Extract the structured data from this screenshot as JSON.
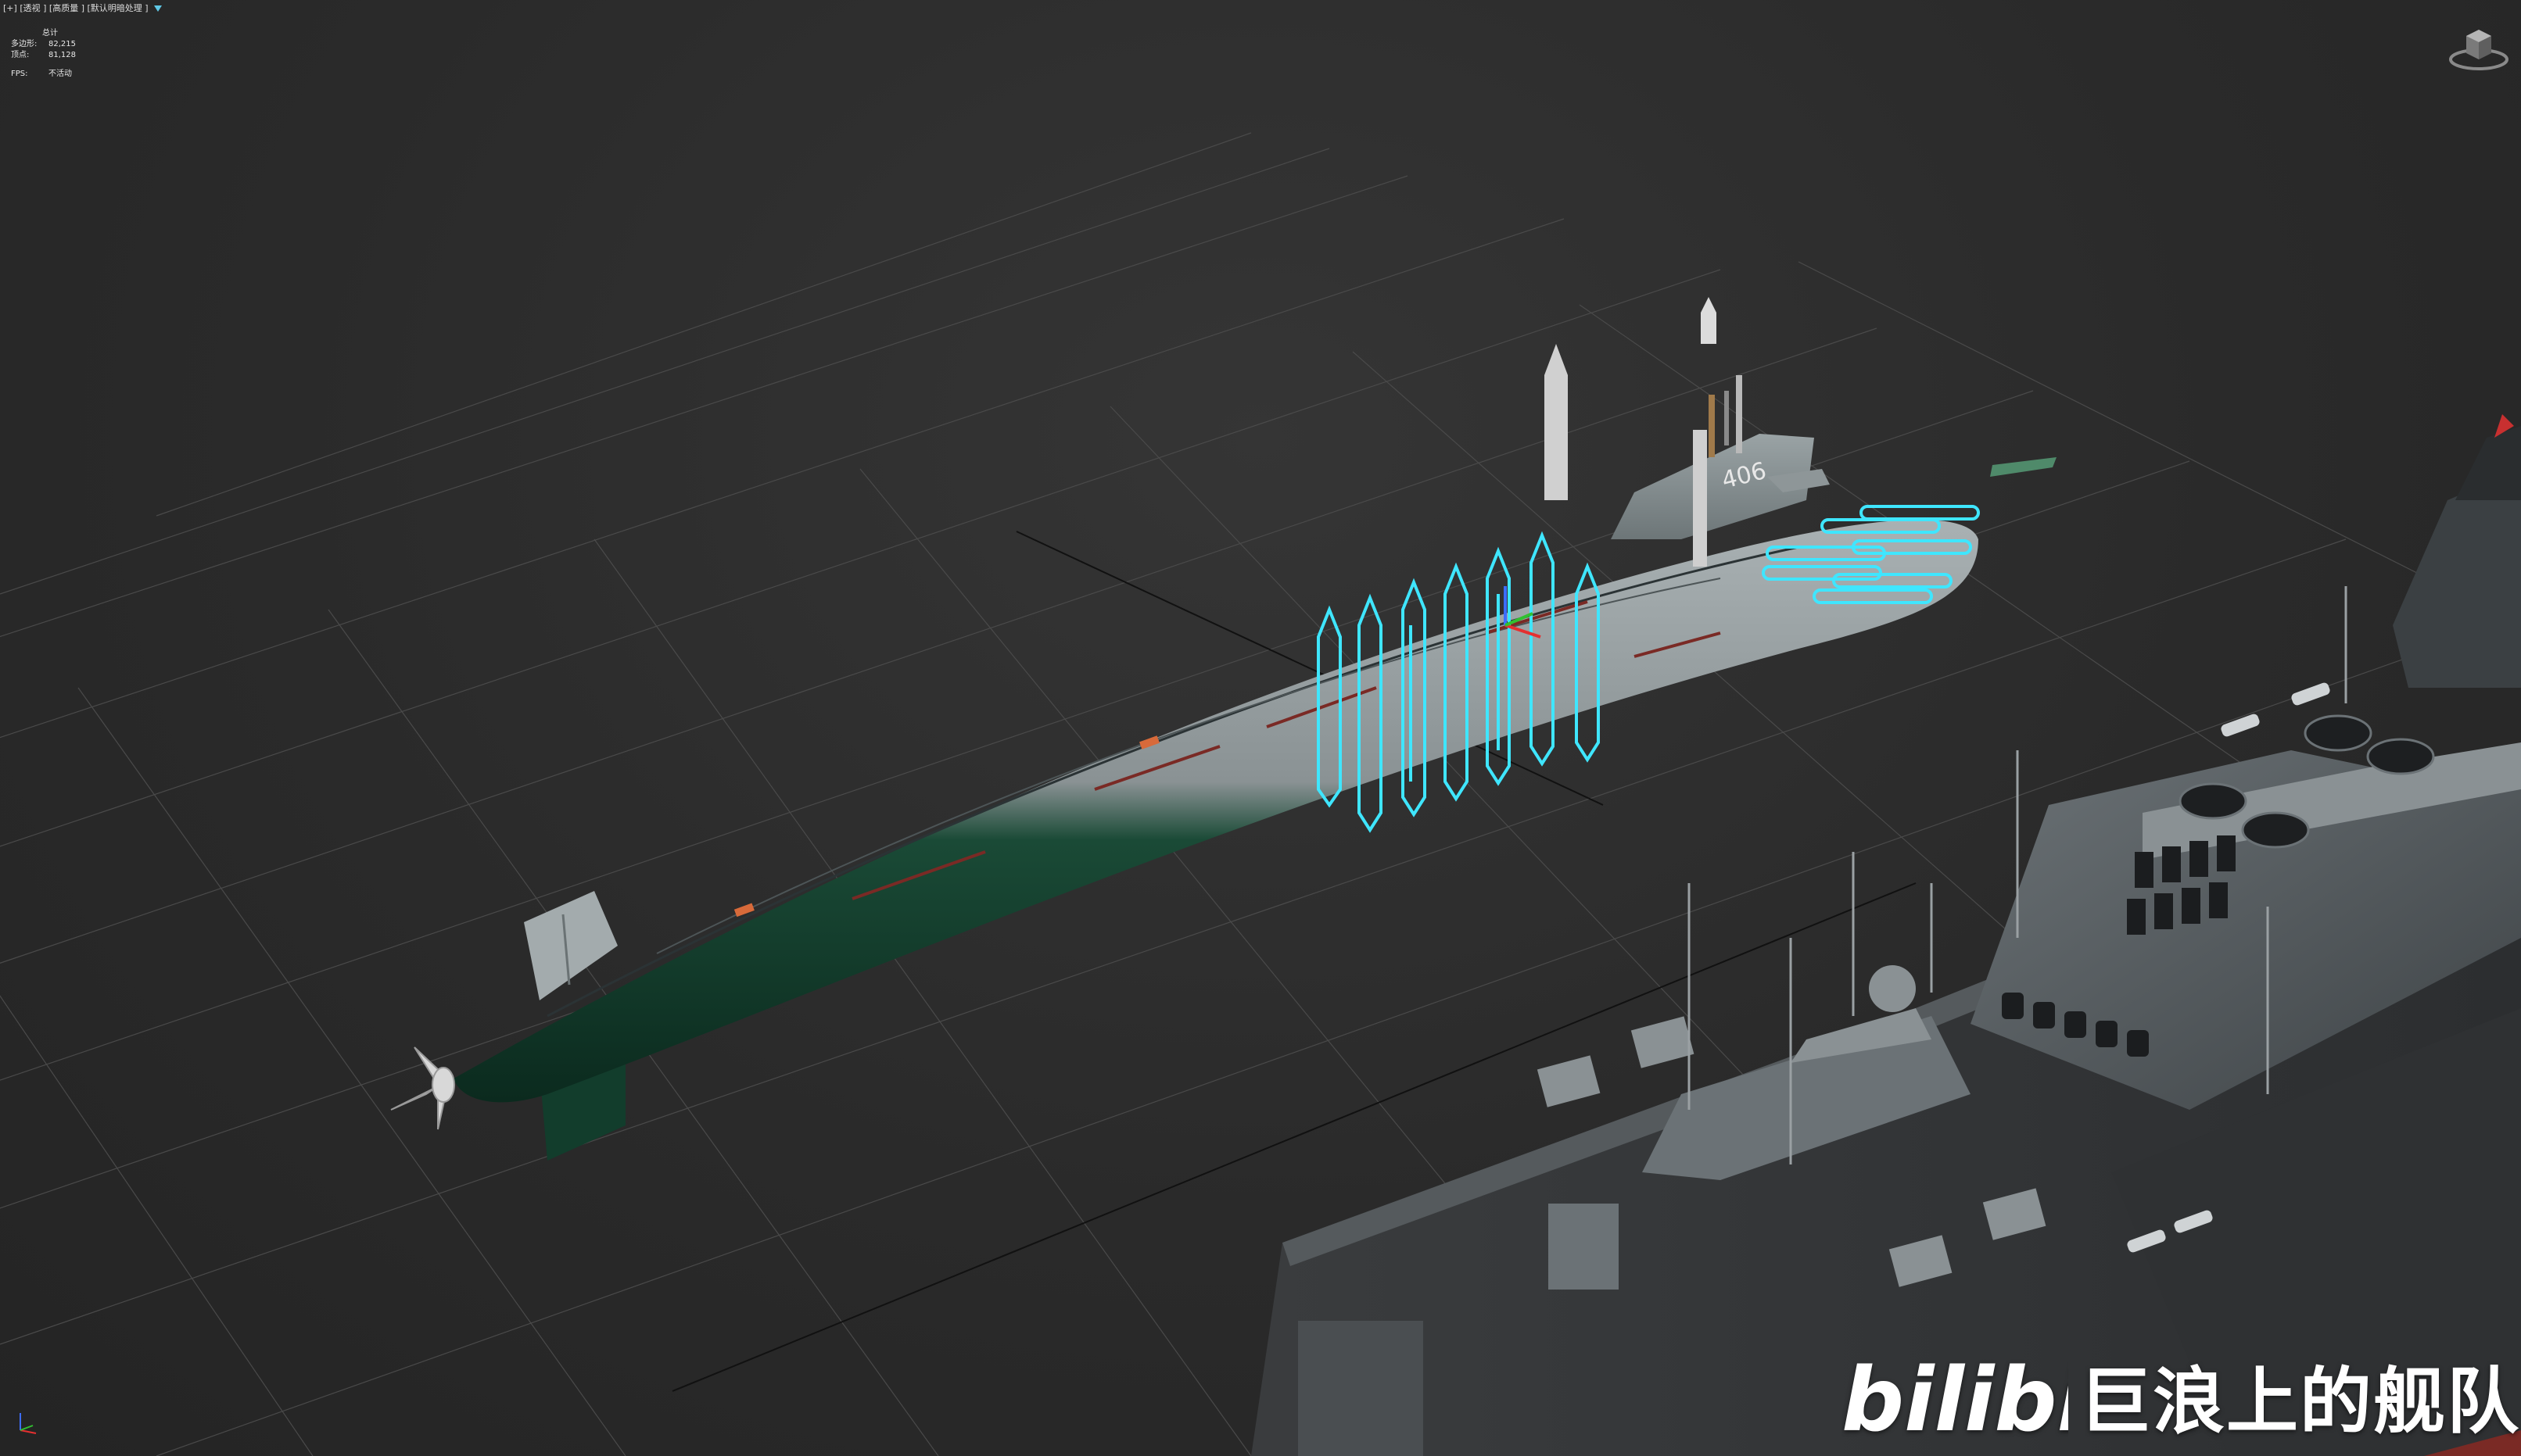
{
  "viewport": {
    "label_plus": "[+]",
    "label_view": "[透视 ]",
    "label_shading": "[高质量 ]",
    "label_lighting": "[默认明暗处理 ]"
  },
  "stats": {
    "title": "总计",
    "polygons_label": "多边形:",
    "polygons_value": "82,215",
    "vertices_label": "顶点:",
    "vertices_value": "81,128",
    "fps_label": "FPS:",
    "fps_value": "不活动"
  },
  "hull": {
    "number": "406"
  },
  "watermark": {
    "logo_text": "bilibili",
    "channel": "巨浪上的舰队"
  },
  "colors": {
    "background": "#2b2b2b",
    "grid": "#4a4a4a",
    "hull_upper": "#8c9597",
    "hull_lower": "#0f3b2a",
    "missile_outline": "#3fe6ff",
    "ship_gray": "#5a6064"
  },
  "icons": {
    "filter": "filter-icon",
    "viewcube": "viewcube-icon",
    "axis": "axis-tripod-icon"
  }
}
